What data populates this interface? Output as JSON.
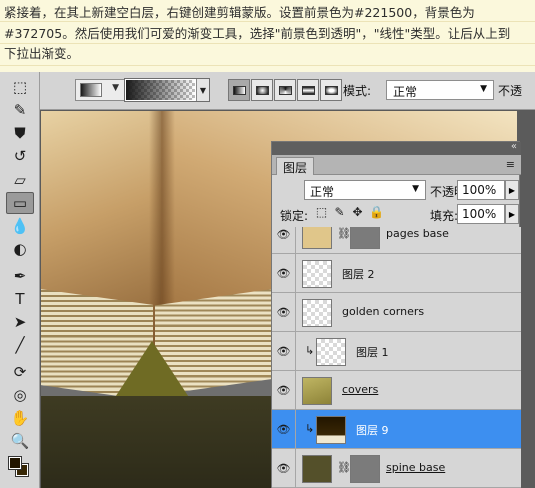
{
  "instruction": {
    "line1": "紧接着，在其上新建空白层，右键创建剪辑蒙版。设置前景色为#221500，背景色为",
    "line2": "#372705。然后使用我们可爱的渐变工具，选择\"前景色到透明\"，\"线性\"类型。让后从上到",
    "line3": "下拉出渐变。"
  },
  "colors": {
    "foreground": "#221500",
    "background": "#372705",
    "selection": "#3d8ff0"
  },
  "tools": [
    {
      "name": "marquee-tool",
      "glyph": "⬚"
    },
    {
      "name": "brush-tool",
      "glyph": "✎"
    },
    {
      "name": "clone-stamp-tool",
      "glyph": "⛊"
    },
    {
      "name": "history-brush-tool",
      "glyph": "↺"
    },
    {
      "name": "eraser-tool",
      "glyph": "▱"
    },
    {
      "name": "gradient-tool",
      "glyph": "▭",
      "active": true
    },
    {
      "name": "blur-tool",
      "glyph": "💧"
    },
    {
      "name": "dodge-tool",
      "glyph": "◐"
    },
    {
      "name": "pen-tool",
      "glyph": "✒"
    },
    {
      "name": "type-tool",
      "glyph": "T"
    },
    {
      "name": "path-selection-tool",
      "glyph": "➤"
    },
    {
      "name": "line-tool",
      "glyph": "╱"
    },
    {
      "name": "3d-rotate-tool",
      "glyph": "⟳"
    },
    {
      "name": "3d-orbit-tool",
      "glyph": "◎"
    },
    {
      "name": "hand-tool",
      "glyph": "✋"
    },
    {
      "name": "zoom-tool",
      "glyph": "🔍"
    }
  ],
  "options_bar": {
    "mode_label": "模式:",
    "mode_value": "正常",
    "opacity_cut": "不透"
  },
  "layers_panel": {
    "tab": "图层",
    "blend_mode": "正常",
    "opacity_label": "不透明度:",
    "opacity_value": "100%",
    "lock_label": "锁定:",
    "fill_label": "填充:",
    "fill_value": "100%",
    "layers": [
      {
        "name": "pages base",
        "has_mask": true,
        "clipped": false,
        "selected": false,
        "underline": false
      },
      {
        "name": "图层 2",
        "has_mask": false,
        "clipped": false,
        "selected": false,
        "underline": false
      },
      {
        "name": "golden corners",
        "has_mask": false,
        "clipped": false,
        "selected": false,
        "underline": false
      },
      {
        "name": "图层 1",
        "has_mask": false,
        "clipped": true,
        "selected": false,
        "underline": false
      },
      {
        "name": "covers",
        "has_mask": false,
        "clipped": false,
        "selected": false,
        "underline": true
      },
      {
        "name": "图层 9",
        "has_mask": false,
        "clipped": true,
        "selected": true,
        "underline": false
      },
      {
        "name": "spine base",
        "has_mask": true,
        "clipped": false,
        "selected": false,
        "underline": true
      }
    ]
  }
}
